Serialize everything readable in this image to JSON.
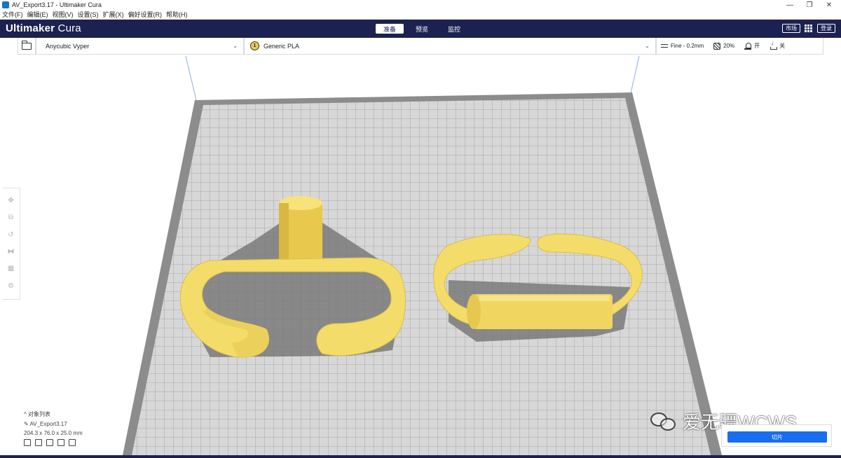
{
  "window": {
    "title": "AV_Export3.17 - Ultimaker Cura",
    "minimize": "—",
    "maximize": "❐",
    "close": "✕"
  },
  "menu": [
    "文件(F)",
    "编辑(E)",
    "视图(V)",
    "设置(S)",
    "扩展(X)",
    "偏好设置(R)",
    "帮助(H)"
  ],
  "header": {
    "brand_bold": "Ultimaker",
    "brand_light": " Cura",
    "stages": [
      {
        "label": "准备",
        "active": true
      },
      {
        "label": "预览",
        "active": false
      },
      {
        "label": "监控",
        "active": false
      }
    ],
    "marketplace": "市场",
    "login": "登录"
  },
  "toolbar": {
    "printer": "Anycubic Vyper",
    "material_index": "1",
    "material": "Generic PLA",
    "profile": "Fine - 0.2mm",
    "infill": "20%",
    "support": "开",
    "adhesion": "关"
  },
  "object_list": {
    "title": "对象列表",
    "object_name": "AV_Export3.17",
    "dimensions": "204.3 x 76.0 x 25.0 mm"
  },
  "watermark": "爱无疆WCWS",
  "slice": {
    "button": "切片"
  },
  "colors": {
    "header_bg": "#1b2150",
    "model_yellow": "#f6e06c",
    "slice_blue": "#196ef0",
    "plate_bg": "#c8c8c8"
  }
}
